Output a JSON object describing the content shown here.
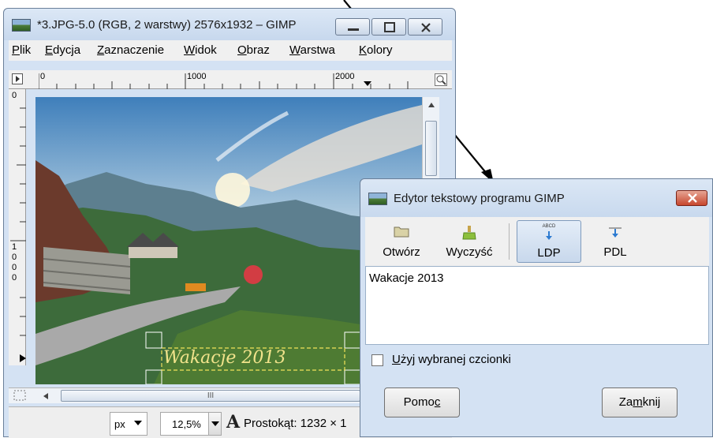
{
  "main_window": {
    "title": "*3.JPG-5.0 (RGB, 2 warstwy) 2576x1932 – GIMP",
    "menu": [
      "Plik",
      "Edycja",
      "Zaznaczenie",
      "Widok",
      "Obraz",
      "Warstwa",
      "Kolory"
    ],
    "ruler_top_labels": [
      "0",
      "1000",
      "2000"
    ],
    "ruler_left_labels": [
      "0",
      "1",
      "0",
      "0",
      "0"
    ],
    "canvas_text": "Wakacje 2013",
    "scroll_mark": "III",
    "status": {
      "unit": "px",
      "zoom": "12,5%",
      "info": "Prostokąt: 1232 × 1"
    }
  },
  "text_editor": {
    "title": "Edytor tekstowy programu GIMP",
    "toolbar": {
      "open": "Otwórz",
      "clear": "Wyczyść",
      "ltr": "LDP",
      "rtl": "PDL",
      "ltr_icon_text": "ABCD"
    },
    "text_value": "Wakacje 2013",
    "checkbox_label": "Użyj wybranej czcionki",
    "checkbox_checked": false,
    "help_button": "Pomoc",
    "close_button": "Zamknij"
  }
}
